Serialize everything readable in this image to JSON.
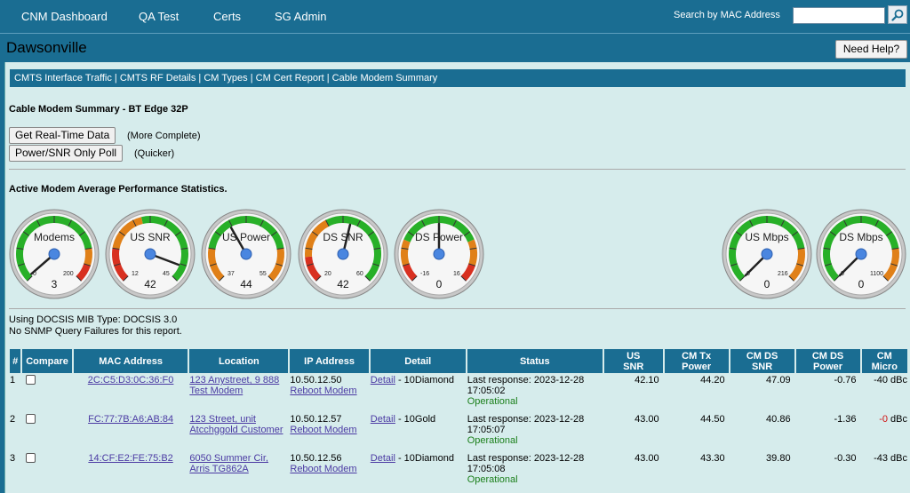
{
  "nav": {
    "items": [
      "CNM Dashboard",
      "QA Test",
      "Certs",
      "SG Admin"
    ],
    "search_label": "Search by MAC Address",
    "search_value": ""
  },
  "title": {
    "site": "Dawsonville",
    "help": "Need Help?"
  },
  "linkbar": {
    "links": [
      "CMTS Interface Traffic",
      "CMTS RF Details",
      "CM Types",
      "CM Cert Report",
      "Cable Modem Summary"
    ]
  },
  "summary": {
    "title": "Cable Modem Summary - BT Edge 32P",
    "btn_realtime": "Get Real-Time Data",
    "note_realtime": "(More Complete)",
    "btn_power": "Power/SNR Only Poll",
    "note_power": "(Quicker)",
    "stats_title": "Active Modem Average Performance Statistics."
  },
  "gauges": [
    {
      "label": "Modems",
      "min": "0",
      "max": "200",
      "value": "3",
      "needle_fraction": 0.015
    },
    {
      "label": "US SNR",
      "min": "12",
      "max": "45",
      "value": "42",
      "needle_fraction": 0.91
    },
    {
      "label": "US Power",
      "min": "37",
      "max": "55",
      "value": "44",
      "needle_fraction": 0.39
    },
    {
      "label": "DS SNR",
      "min": "20",
      "max": "60",
      "value": "42",
      "needle_fraction": 0.55
    },
    {
      "label": "DS Power",
      "min": "-16",
      "max": "16",
      "value": "0",
      "needle_fraction": 0.5
    },
    {
      "label": "US Mbps",
      "min": "0",
      "max": "216",
      "value": "0",
      "needle_fraction": 0.0
    },
    {
      "label": "DS Mbps",
      "min": "0",
      "max": "1100",
      "value": "0",
      "needle_fraction": 0.0
    }
  ],
  "info": {
    "mib": "Using DOCSIS MIB Type: DOCSIS 3.0",
    "snmp": "No SNMP Query Failures for this report."
  },
  "table": {
    "headers": [
      "#",
      "Compare",
      "MAC Address",
      "Location",
      "IP Address",
      "Detail",
      "Status",
      "US\nSNR",
      "CM Tx\nPower",
      "CM DS\nSNR",
      "CM DS\nPower",
      "CM\nMicro"
    ],
    "rows": [
      {
        "n": "1",
        "mac": "2C:C5:D3:0C:36:F0",
        "loc": "123 Anystreet, 9 888 Test Modem",
        "ip": "10.50.12.50",
        "reboot": "Reboot Modem",
        "detail_link": "Detail",
        "detail_text": " - 10Diamond",
        "status": "Last response: 2023-12-28 17:05:02",
        "op": "Operational",
        "us_snr": "42.10",
        "tx": "44.20",
        "ds_snr": "47.09",
        "ds_pow": "-0.76",
        "micro": "-40",
        "micro_unit": " dBc",
        "micro_red": false
      },
      {
        "n": "2",
        "mac": "FC:77:7B:A6:AB:84",
        "loc": "123 Street, unit Atcchggold Customer",
        "ip": "10.50.12.57",
        "reboot": "Reboot Modem",
        "detail_link": "Detail",
        "detail_text": " - 10Gold",
        "status": "Last response: 2023-12-28 17:05:07",
        "op": "Operational",
        "us_snr": "43.00",
        "tx": "44.50",
        "ds_snr": "40.86",
        "ds_pow": "-1.36",
        "micro": "-0",
        "micro_unit": " dBc",
        "micro_red": true
      },
      {
        "n": "3",
        "mac": "14:CF:E2:FE:75:B2",
        "loc": "6050 Summer Cir, Arris TG862A",
        "ip": "10.50.12.56",
        "reboot": "Reboot Modem",
        "detail_link": "Detail",
        "detail_text": " - 10Diamond",
        "status": "Last response: 2023-12-28 17:05:08",
        "op": "Operational",
        "us_snr": "43.00",
        "tx": "43.30",
        "ds_snr": "39.80",
        "ds_pow": "-0.30",
        "micro": "-43",
        "micro_unit": " dBc",
        "micro_red": false
      }
    ]
  },
  "colors": {
    "brand": "#1a6d92",
    "content_bg": "#d6ecec",
    "ok": "#1a7f1a",
    "bad": "#d01010",
    "link": "#4b3aa3"
  }
}
